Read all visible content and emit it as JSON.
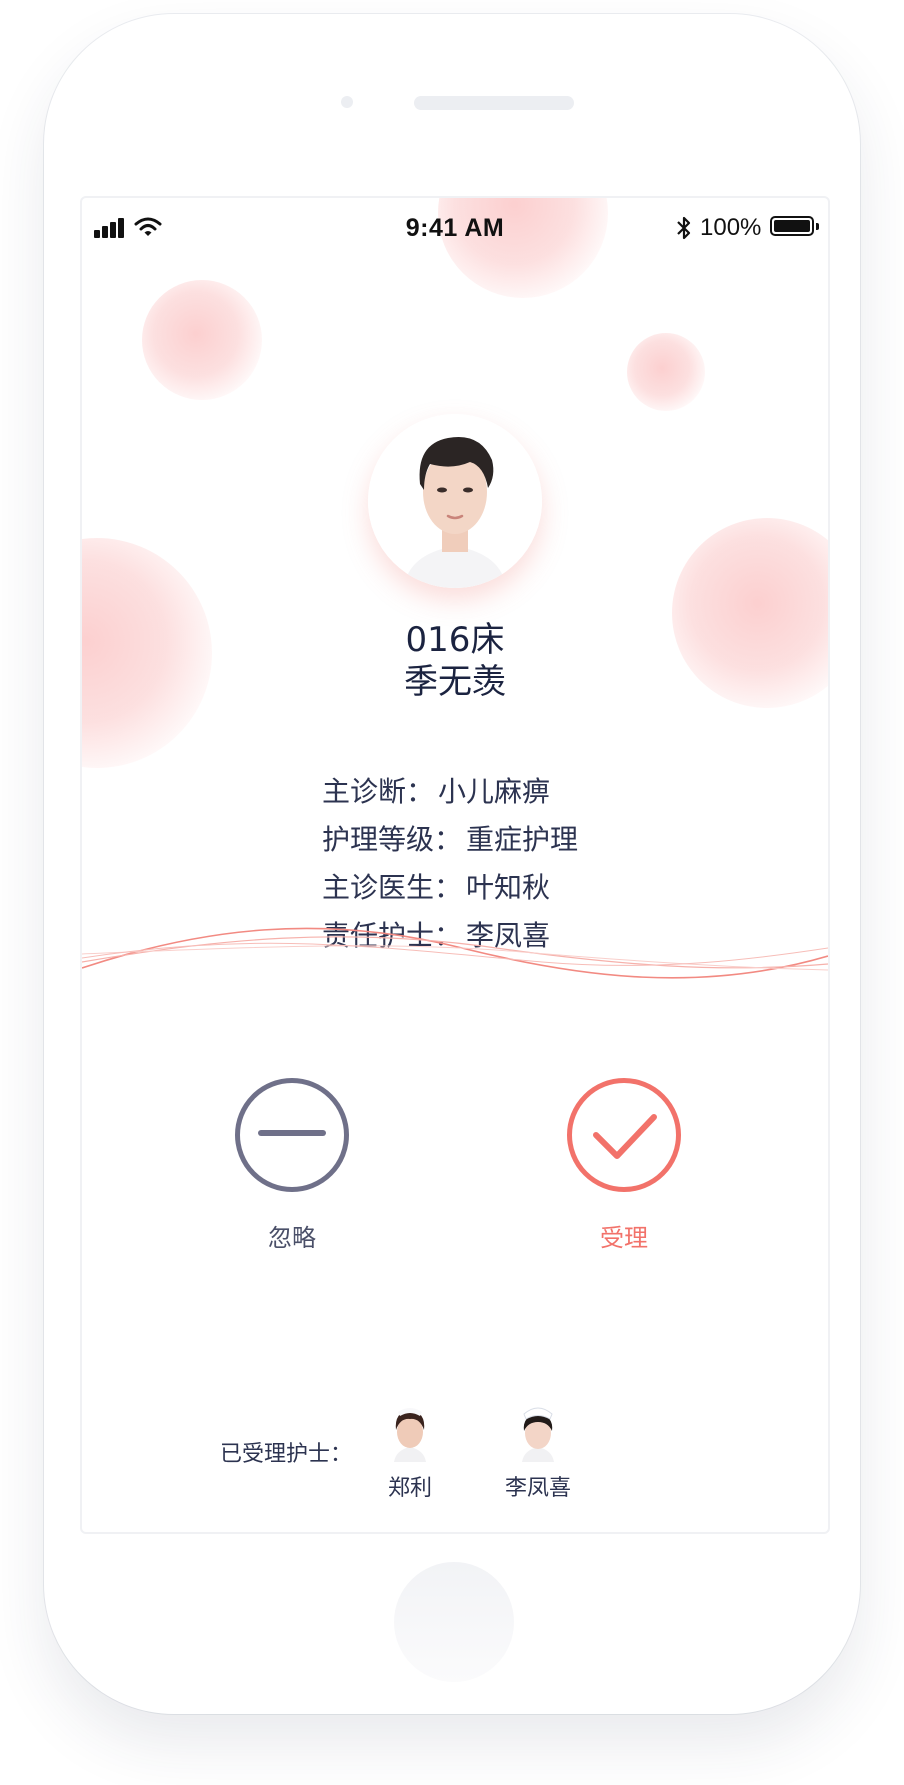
{
  "status_bar": {
    "time": "9:41 AM",
    "battery": "100%"
  },
  "patient": {
    "bed": "016床",
    "name": "季无羡",
    "info": [
      {
        "label": "主诊断：",
        "value": "小儿麻痹"
      },
      {
        "label": "护理等级：",
        "value": "重症护理"
      },
      {
        "label": "主诊医生：",
        "value": "叶知秋"
      },
      {
        "label": "责任护士：",
        "value": "李凤喜"
      }
    ]
  },
  "actions": {
    "ignore_label": "忽略",
    "accept_label": "受理"
  },
  "accepted": {
    "label": "已受理护士：",
    "nurses": [
      {
        "name": "郑利"
      },
      {
        "name": "李凤喜"
      }
    ]
  },
  "colors": {
    "accent": "#f2726a",
    "neutral": "#6f7089",
    "text": "#1b2340"
  },
  "icons": {
    "signal": "cellular-signal-icon",
    "wifi": "wifi-icon",
    "bluetooth": "bluetooth-icon",
    "battery": "battery-icon",
    "ignore": "minus-circle-icon",
    "accept": "check-circle-icon"
  }
}
